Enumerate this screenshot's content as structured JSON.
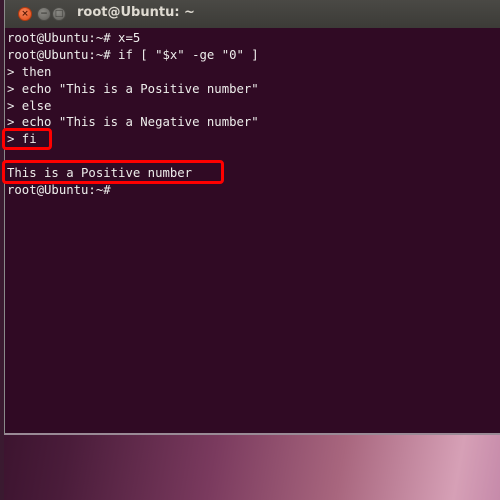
{
  "window": {
    "title": "root@Ubuntu: ~",
    "buttons": {
      "close": "×",
      "minimize": "−",
      "maximize": "□"
    }
  },
  "terminal": {
    "lines": [
      "root@Ubuntu:~# x=5",
      "root@Ubuntu:~# if [ \"$x\" -ge \"0\" ]",
      "> then",
      "> echo \"This is a Positive number\"",
      "> else",
      "> echo \"This is a Negative number\"",
      "> fi",
      "",
      "This is a Positive number",
      "root@Ubuntu:~#"
    ]
  },
  "annotations": {
    "highlight_color": "#ff0000",
    "highlighted": [
      "> fi",
      "This is a Positive number"
    ]
  },
  "colors": {
    "terminal_bg": "#300a24",
    "text": "#eeeeec",
    "titlebar": "#3c3b37"
  }
}
